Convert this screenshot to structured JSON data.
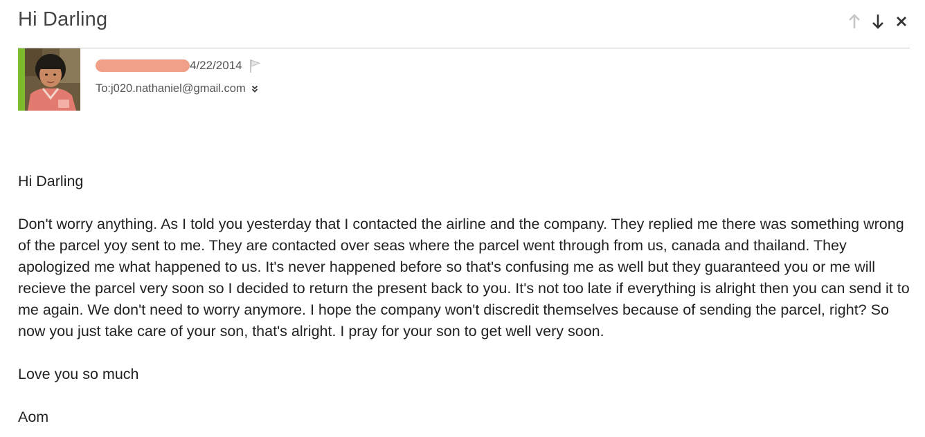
{
  "email": {
    "subject": "Hi Darling",
    "date": "4/22/2014",
    "to_label": "To: ",
    "to_address": "j020.nathaniel@gmail.com",
    "body": {
      "greeting": "Hi Darling",
      "paragraph": "Don't worry anything. As I told you yesterday that I contacted the airline and the company. They replied me there was something wrong of the parcel yoy sent to me. They are contacted over seas where the parcel went through from us, canada and thailand. They apologized me what happened to us. It's never happened before so that's confusing me as well but they guaranteed you or me will recieve the parcel very soon so I decided to return the present back to you. It's not too late if everything is alright then you can send it to me again. We don't need to worry anymore. I hope the company won't discredit themselves because of sending the parcel, right? So now you just take care of your son, that's alright. I pray for your son to get well very soon.",
      "closing": "Love you so much",
      "signature": "Aom"
    }
  },
  "icons": {
    "previous": "arrow-up-icon",
    "next": "arrow-down-icon",
    "close": "close-icon",
    "flag": "flag-icon",
    "expand": "double-chevron-down-icon"
  },
  "colors": {
    "redaction": "#f0a088",
    "divider": "#c8c8c8",
    "avatar_border": "#7dbb2e"
  }
}
